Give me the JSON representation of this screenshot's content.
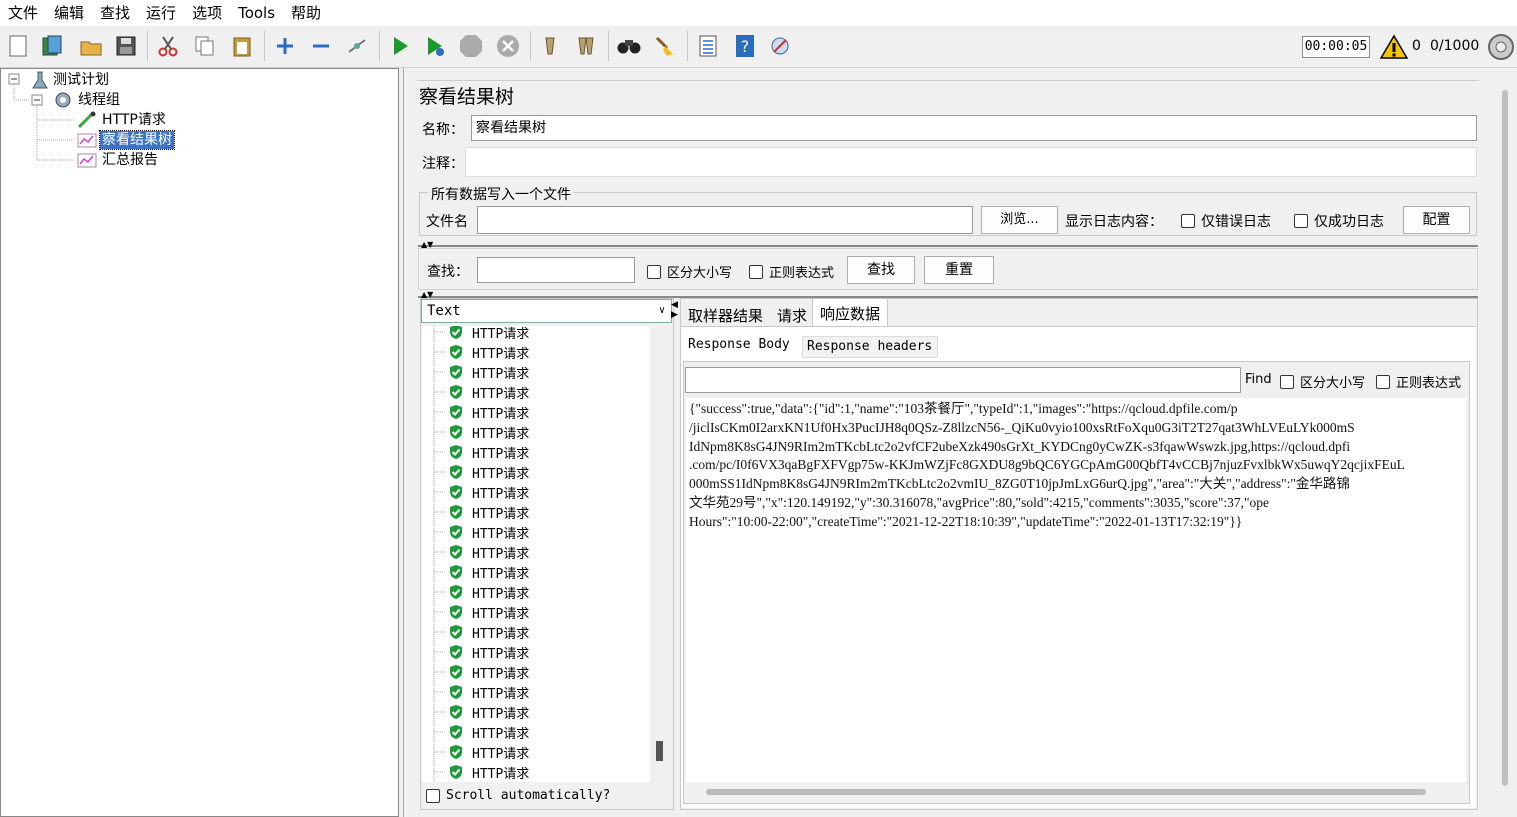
{
  "menu": [
    "文件",
    "编辑",
    "查找",
    "运行",
    "选项",
    "Tools",
    "帮助"
  ],
  "toolbar": {
    "timer": "00:00:05",
    "warning_count": "0",
    "thread_count": "0/1000"
  },
  "tree": {
    "root": "测试计划",
    "thread_group": "线程组",
    "http_request": "HTTP请求",
    "view_results_tree": "察看结果树",
    "summary_report": "汇总报告"
  },
  "panel": {
    "title": "察看结果树",
    "name_label": "名称：",
    "name_value": "察看结果树",
    "comment_label": "注释：",
    "comment_value": "",
    "file_group_title": "所有数据写入一个文件",
    "filename_label": "文件名",
    "filename_value": "",
    "browse_button": "浏览...",
    "log_content_label": "显示日志内容：",
    "errors_only": "仅错误日志",
    "success_only": "仅成功日志",
    "configure_button": "配置"
  },
  "search": {
    "label": "查找：",
    "value": "",
    "case_sensitive": "区分大小写",
    "regex": "正则表达式",
    "find_button": "查找",
    "reset_button": "重置"
  },
  "renderer": {
    "selected": "Text",
    "scroll_auto": "Scroll automatically?"
  },
  "results": {
    "item_label": "HTTP请求",
    "items": [
      "HTTP请求",
      "HTTP请求",
      "HTTP请求",
      "HTTP请求",
      "HTTP请求",
      "HTTP请求",
      "HTTP请求",
      "HTTP请求",
      "HTTP请求",
      "HTTP请求",
      "HTTP请求",
      "HTTP请求",
      "HTTP请求",
      "HTTP请求",
      "HTTP请求",
      "HTTP请求",
      "HTTP请求",
      "HTTP请求",
      "HTTP请求",
      "HTTP请求",
      "HTTP请求",
      "HTTP请求",
      "HTTP请求"
    ]
  },
  "tabs": {
    "sampler_result": "取样器结果",
    "request": "请求",
    "response_data": "响应数据",
    "response_body": "Response Body",
    "response_headers": "Response headers"
  },
  "find_bar": {
    "label": "Find",
    "case_sensitive": "区分大小写",
    "regex": "正则表达式"
  },
  "response_text": "{\"success\":true,\"data\":{\"id\":1,\"name\":\"103茶餐厅\",\"typeId\":1,\"images\":\"https://qcloud.dpfile.com/p\n/jiclIsCKm0I2arxKN1Uf0Hx3PucIJH8q0QSz-Z8llzcN56-_QiKu0vyio100xsRtFoXqu0G3iT2T27qat3WhLVEuLYk000mS\nIdNpm8K8sG4JN9RIm2mTKcbLtc2o2vfCF2ubeXzk490sGrXt_KYDCng0yCwZK-s3fqawWswzk.jpg,https://qcloud.dpfi\n.com/pc/I0f6VX3qaBgFXFVgp75w-KKJmWZjFc8GXDU8g9bQC6YGCpAmG00QbfT4vCCBj7njuzFvxlbkWx5uwqY2qcjixFEuL\n000mSS1IdNpm8K8sG4JN9RIm2mTKcbLtc2o2vmIU_8ZG0T10jpJmLxG6urQ.jpg\",\"area\":\"大关\",\"address\":\"金华路锦\n文华苑29号\",\"x\":120.149192,\"y\":30.316078,\"avgPrice\":80,\"sold\":4215,\"comments\":3035,\"score\":37,\"ope\nHours\":\"10:00-22:00\",\"createTime\":\"2021-12-22T18:10:39\",\"updateTime\":\"2022-01-13T17:32:19\"}}"
}
